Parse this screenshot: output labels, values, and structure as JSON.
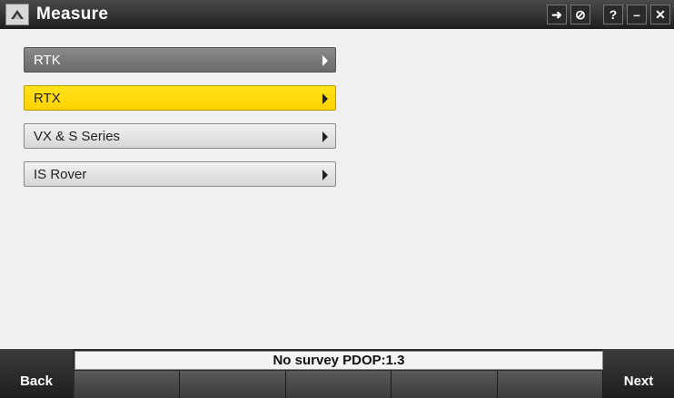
{
  "window": {
    "title": "Measure"
  },
  "toolbar": {
    "buttons": [
      {
        "name": "swap-arrow-icon",
        "glyph": "➜"
      },
      {
        "name": "cancel-icon",
        "glyph": "⊘"
      },
      {
        "name": "help-icon",
        "glyph": "?"
      },
      {
        "name": "minimize-icon",
        "glyph": "–"
      },
      {
        "name": "close-icon",
        "glyph": "✕"
      }
    ]
  },
  "menu": {
    "items": [
      {
        "label": "RTK"
      },
      {
        "label": "RTX"
      },
      {
        "label": "VX & S Series"
      },
      {
        "label": "IS Rover"
      }
    ]
  },
  "status": {
    "text": "No survey  PDOP:1.3"
  },
  "nav": {
    "back_label": "Back",
    "next_label": "Next"
  },
  "colors": {
    "selected": "#FFD400",
    "dark": "#6E6E6E",
    "titlebar": "#2B2B2B"
  }
}
